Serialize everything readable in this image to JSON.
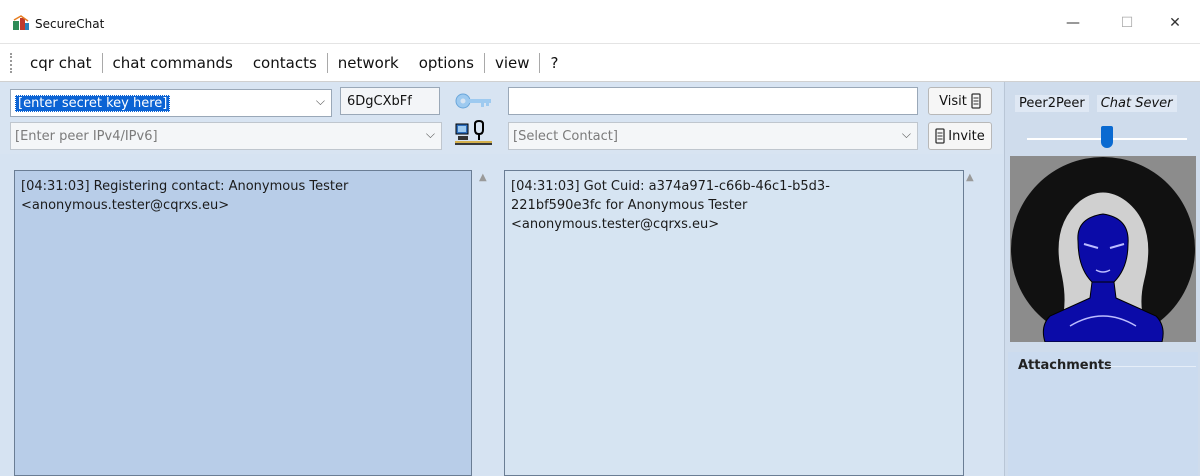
{
  "window": {
    "title": "SecureChat",
    "minimize": "—",
    "maximize": "☐",
    "close": "✕"
  },
  "menu": {
    "items": [
      "cqr chat",
      "chat commands",
      "contacts",
      "network",
      "options",
      "view",
      "?"
    ]
  },
  "toolbar": {
    "secret_key_value": "[enter secret key here]",
    "key_hash": "6DgCXbFf",
    "message_input_value": "",
    "visit_label": "Visit",
    "peer_ip_placeholder": "[Enter peer IPv4/IPv6]",
    "contact_placeholder": "[Select Contact]",
    "invite_label": "Invite"
  },
  "chat": {
    "left_log": "[04:31:03] Registering contact: Anonymous Tester <anonymous.tester@cqrxs.eu>",
    "right_log_line1": "[04:31:03] Got Cuid: a374a971-c66b-46c1-b5d3-",
    "right_log_line2": "221bf590e3fc for Anonymous Tester",
    "right_log_line3": "<anonymous.tester@cqrxs.eu>"
  },
  "side": {
    "peer_tab": "Peer2Peer",
    "server_tab": "Chat Sever",
    "attachments_label": "Attachments",
    "slider_level": 0.52
  },
  "colors": {
    "accent": "#0b63d4",
    "pane_left": "#b8cde8",
    "pane_right": "#d6e4f2",
    "avatar_fill": "#0b0ba8"
  }
}
